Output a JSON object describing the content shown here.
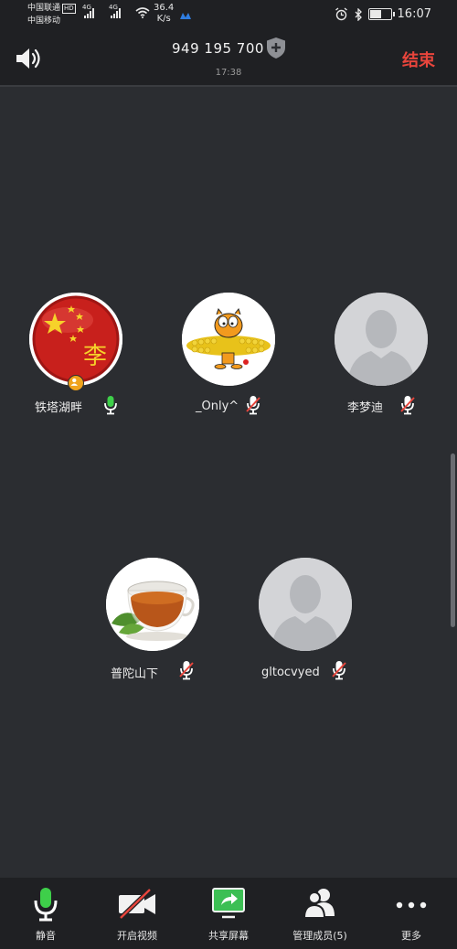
{
  "status_bar": {
    "carrier_1": "中国联通",
    "carrier_1_badge": "HD",
    "carrier_2": "中国移动",
    "network_1": "4G",
    "network_2": "4G",
    "speed_value": "36.4",
    "speed_unit": "K/s",
    "time": "16:07",
    "battery_level": 0.55
  },
  "header": {
    "meeting_id": "949 195 700",
    "duration": "17:38",
    "end_label": "结束",
    "end_color": "#e8453c"
  },
  "participants": [
    {
      "name": "铁塔湖畔",
      "mic": "on",
      "host": true,
      "avatar": "china-flag-avatar",
      "avatar_text": "李"
    },
    {
      "name": "_Only^",
      "mic": "muted",
      "host": false,
      "avatar": "garfield-avatar"
    },
    {
      "name": "李梦迪",
      "mic": "muted",
      "host": false,
      "avatar": "default-person-avatar"
    },
    {
      "name": "普陀山下",
      "mic": "muted",
      "host": false,
      "avatar": "tea-cup-avatar"
    },
    {
      "name": "gltocvyed",
      "mic": "muted",
      "host": false,
      "avatar": "default-person-avatar"
    }
  ],
  "toolbar": {
    "mute_label": "静音",
    "video_label": "开启视频",
    "share_label": "共享屏幕",
    "members_label": "管理成员(5)",
    "more_label": "更多"
  },
  "colors": {
    "mic_on": "#3ecf4a",
    "mic_muted_slash": "#e8453c",
    "host_badge": "#f0a31c",
    "share_green": "#3cbf54"
  }
}
